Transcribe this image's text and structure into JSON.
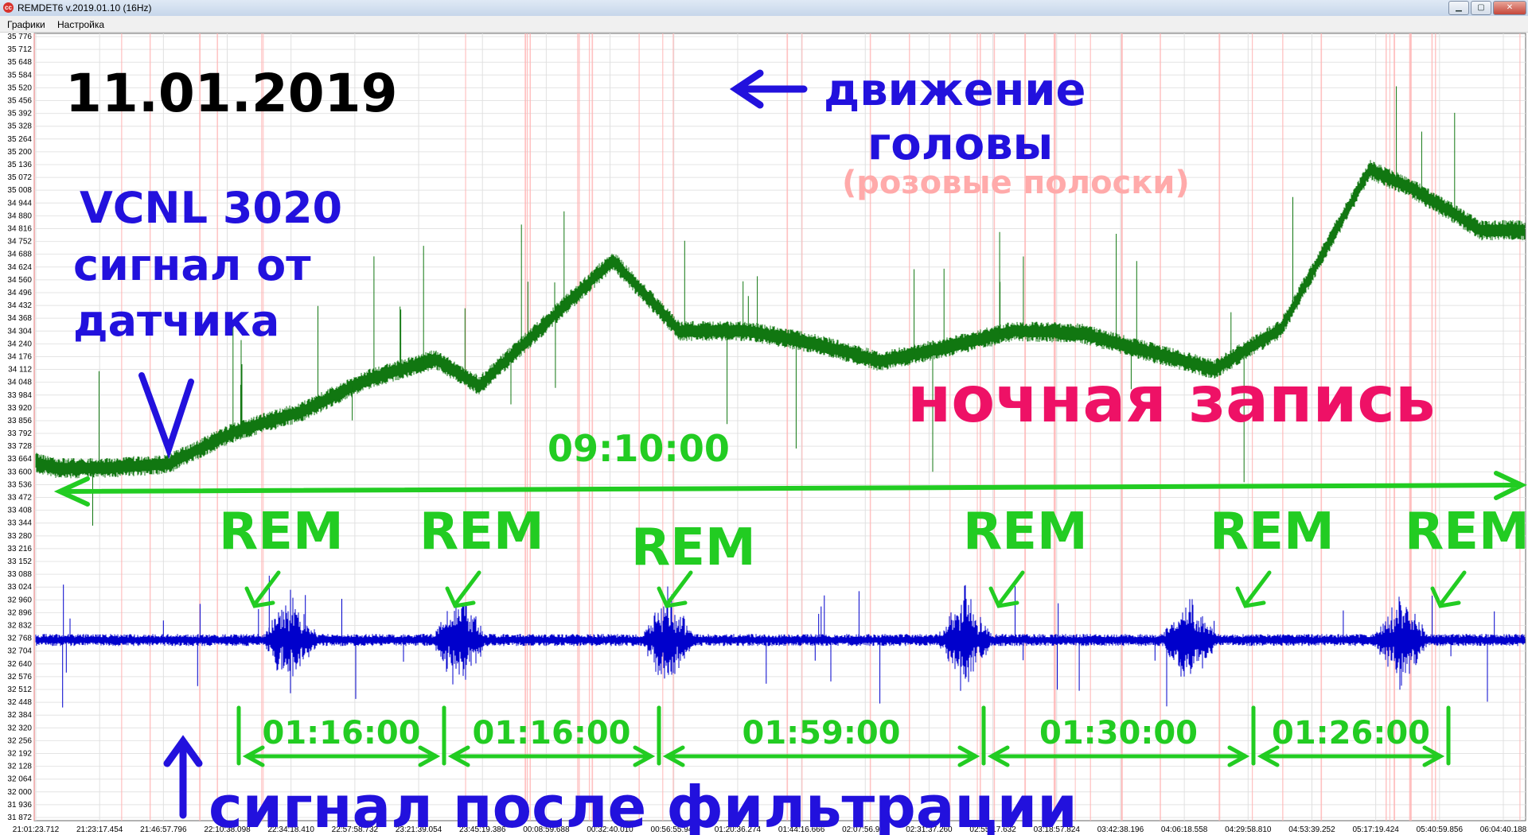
{
  "window": {
    "title": "REMDET6 v.2019.01.10 (16Hz)",
    "icon": "app-logo-icon",
    "controls": [
      "minimize-icon",
      "maximize-icon",
      "close-icon"
    ]
  },
  "menu": {
    "items": [
      "Графики",
      "Настройка"
    ]
  },
  "colors": {
    "raw_signal": "#117711",
    "filtered_signal": "#0000cc",
    "annotation_green": "#22cc22",
    "annotation_blue": "#2211dd",
    "annotation_pink": "#ffaaaa",
    "annotation_red": "#ee1166",
    "grid": "#e4e4e4",
    "movement_marker": "#ffb4b4"
  },
  "chart_data": {
    "type": "line",
    "title": "",
    "xlabel": "",
    "ylabel": "",
    "ylim": [
      31872,
      35776
    ],
    "y_ticks": [
      "35 776",
      "35 712",
      "35 648",
      "35 584",
      "35 520",
      "35 456",
      "35 392",
      "35 328",
      "35 264",
      "35 200",
      "35 136",
      "35 072",
      "35 008",
      "34 944",
      "34 880",
      "34 816",
      "34 752",
      "34 688",
      "34 624",
      "34 560",
      "34 496",
      "34 432",
      "34 368",
      "34 304",
      "34 240",
      "34 176",
      "34 112",
      "34 048",
      "33 984",
      "33 920",
      "33 856",
      "33 792",
      "33 728",
      "33 664",
      "33 600",
      "33 536",
      "33 472",
      "33 408",
      "33 344",
      "33 280",
      "33 216",
      "33 152",
      "33 088",
      "33 024",
      "32 960",
      "32 896",
      "32 832",
      "32 768",
      "32 704",
      "32 640",
      "32 576",
      "32 512",
      "32 448",
      "32 384",
      "32 320",
      "32 256",
      "32 192",
      "32 128",
      "32 064",
      "32 000",
      "31 936",
      "31 872"
    ],
    "x_ticks": [
      "21:01:23.712",
      "21:23:17.454",
      "21:46:57.796",
      "22:10:38.098",
      "22:34:18.410",
      "22:57:58.732",
      "23:21:39.054",
      "23:45:19.386",
      "00:08:59.688",
      "00:32:40.010",
      "00:56:55.942",
      "01:20:36.274",
      "01:44:16.666",
      "02:07:56.908",
      "02:31:37.260",
      "02:55:17.632",
      "03:18:57.824",
      "03:42:38.196",
      "04:06:18.558",
      "04:29:58.810",
      "04:53:39.252",
      "05:17:19.424",
      "05:40:59.856",
      "06:04:40.188"
    ],
    "series": [
      {
        "name": "VCNL 3020",
        "x_minutes": [
          0,
          10,
          30,
          60,
          90,
          120,
          150,
          180,
          200,
          230,
          260,
          290,
          320,
          350,
          380,
          410,
          440,
          470,
          500,
          530,
          560,
          600,
          620,
          650
        ],
        "values": [
          33650,
          33620,
          33620,
          33640,
          33800,
          33900,
          34060,
          34160,
          34030,
          34340,
          34650,
          34300,
          34300,
          34240,
          34150,
          34220,
          34300,
          34290,
          34200,
          34110,
          34310,
          35100,
          35000,
          34800
        ]
      },
      {
        "name": "Сигнал после фильтрации",
        "baseline": 32768,
        "rem_bursts_minutes": [
          115,
          191,
          285,
          418,
          519,
          614
        ],
        "burst_amplitude": 220,
        "noise_amplitude": 30
      }
    ],
    "annotations": {
      "date": "11.01.2019",
      "sensor": [
        "VCNL 3020",
        "сигнал от",
        "датчика"
      ],
      "head_movement": [
        "движение",
        "головы"
      ],
      "pink_bars_note": "(розовые полоски)",
      "night_record": "ночная запись",
      "total_duration": "09:10:00",
      "rem_label": "REM",
      "rem_intervals": [
        "01:16:00",
        "01:16:00",
        "01:59:00",
        "01:30:00",
        "01:26:00"
      ],
      "filtered_label": "сигнал после фильтрации"
    }
  }
}
